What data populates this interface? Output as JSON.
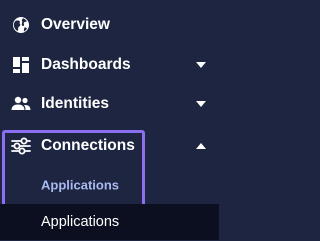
{
  "nav": {
    "items": [
      {
        "label": "Overview",
        "icon": "globe-icon"
      },
      {
        "label": "Dashboards",
        "icon": "dashboard-icon",
        "chevron": "down"
      },
      {
        "label": "Identities",
        "icon": "users-icon",
        "chevron": "down"
      },
      {
        "label": "Connections",
        "icon": "sliders-icon",
        "chevron": "up",
        "expanded": true,
        "children": [
          {
            "label": "Applications",
            "kind": "section-header"
          },
          {
            "label": "Applications",
            "kind": "link",
            "active": true
          }
        ]
      }
    ]
  },
  "colors": {
    "background": "#1d2540",
    "text": "#ffffff",
    "sub_header": "#a9b9f2",
    "highlight_border": "#8c6ff0",
    "active_row": "#0b0f1f"
  }
}
